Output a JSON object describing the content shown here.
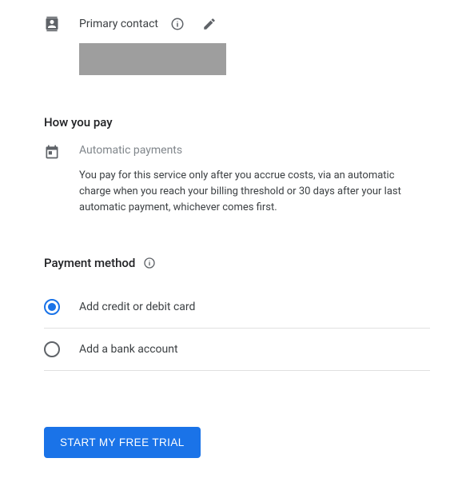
{
  "contact": {
    "label": "Primary contact"
  },
  "how_you_pay": {
    "title": "How you pay",
    "method_label": "Automatic payments",
    "description": "You pay for this service only after you accrue costs, via an automatic charge when you reach your billing threshold or 30 days after your last automatic payment, whichever comes first."
  },
  "payment_method": {
    "title": "Payment method",
    "options": [
      {
        "label": "Add credit or debit card",
        "selected": true
      },
      {
        "label": "Add a bank account",
        "selected": false
      }
    ]
  },
  "cta": {
    "label": "START MY FREE TRIAL"
  }
}
